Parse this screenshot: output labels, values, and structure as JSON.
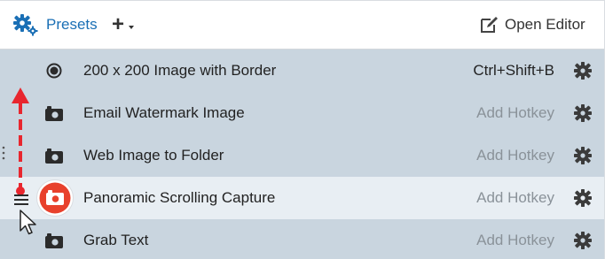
{
  "header": {
    "presets_label": "Presets",
    "add_label": "+",
    "open_editor_label": "Open Editor",
    "presets_color": "#1a6fb5"
  },
  "presets": [
    {
      "name": "200 x 200 Image with Border",
      "hotkey": "Ctrl+Shift+B",
      "hotkey_set": true,
      "icon": "radio-record-icon",
      "selected": false
    },
    {
      "name": "Email Watermark Image",
      "hotkey": "Add Hotkey",
      "hotkey_set": false,
      "icon": "camera-icon",
      "selected": false
    },
    {
      "name": "Web Image to Folder",
      "hotkey": "Add Hotkey",
      "hotkey_set": false,
      "icon": "camera-icon",
      "selected": false
    },
    {
      "name": "Panoramic Scrolling Capture",
      "hotkey": "Add Hotkey",
      "hotkey_set": false,
      "icon": "capture-button-icon",
      "selected": true
    },
    {
      "name": "Grab Text",
      "hotkey": "Add Hotkey",
      "hotkey_set": false,
      "icon": "camera-icon",
      "selected": false
    }
  ],
  "colors": {
    "row_background": "#c9d5df",
    "selected_row_background": "#e8eef3",
    "capture_button_red": "#e8412c",
    "drag_arrow_red": "#e8262e"
  }
}
